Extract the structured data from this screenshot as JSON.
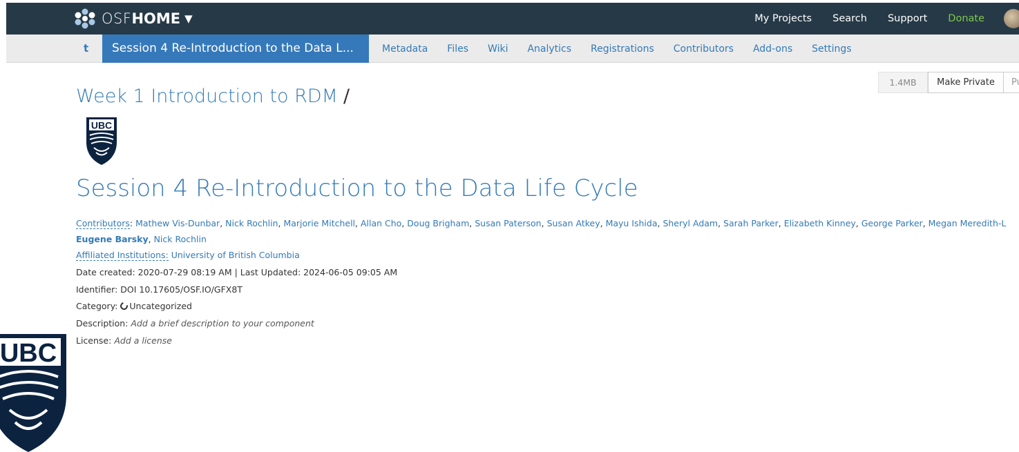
{
  "topnav": {
    "brand_osf": "OSF",
    "brand_home": "HOME",
    "links": [
      "My Projects",
      "Search",
      "Support"
    ],
    "donate": "Donate"
  },
  "projectnav": {
    "short": "t",
    "title": "Session 4 Re-Introduction to the Data L...",
    "tabs": [
      "Metadata",
      "Files",
      "Wiki",
      "Analytics",
      "Registrations",
      "Contributors",
      "Add-ons",
      "Settings"
    ]
  },
  "header": {
    "parent": "Week 1 Introduction to RDM",
    "slash": "/",
    "size": "1.4MB",
    "make_private": "Make Private",
    "make_public": "Pu"
  },
  "title": "Session 4 Re-Introduction to the Data Life Cycle",
  "meta": {
    "contributors_label": "Contributors",
    "contributors": [
      "Mathew Vis-Dunbar",
      "Nick Rochlin",
      "Marjorie Mitchell",
      "Allan Cho",
      "Doug Brigham",
      "Susan Paterson",
      "Susan Atkey",
      "Mayu Ishida",
      "Sheryl Adam",
      "Sarah Parker",
      "Elizabeth Kinney",
      "George Parker",
      "Megan Meredith-L"
    ],
    "contributors_line2_bold": "Eugene Barsky",
    "contributors_line2": "Nick Rochlin",
    "institutions_label": "Affiliated Institutions:",
    "institution": "University of British Columbia",
    "date_line": "Date created: 2020-07-29 08:19 AM | Last Updated: 2024-06-05 09:05 AM",
    "identifier": "Identifier: DOI 10.17605/OSF.IO/GFX8T",
    "category_label": "Category:",
    "category": "Uncategorized",
    "description_label": "Description:",
    "description": "Add a brief description to your component",
    "license_label": "License:",
    "license": "Add a license"
  },
  "logo_text": "UBC",
  "colors": {
    "topbar": "#263947",
    "link": "#337ab7",
    "donate": "#7ec84b",
    "active_tab": "#3679ba"
  }
}
